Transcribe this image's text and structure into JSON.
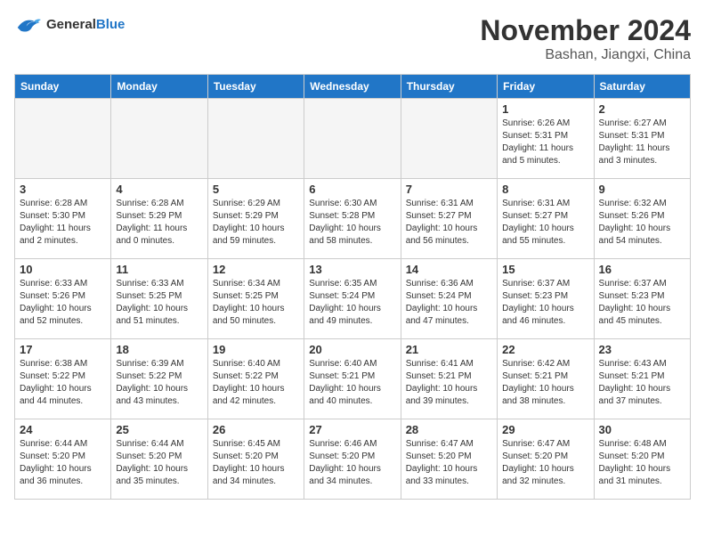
{
  "header": {
    "logo_general": "General",
    "logo_blue": "Blue",
    "month_title": "November 2024",
    "location": "Bashan, Jiangxi, China"
  },
  "weekdays": [
    "Sunday",
    "Monday",
    "Tuesday",
    "Wednesday",
    "Thursday",
    "Friday",
    "Saturday"
  ],
  "weeks": [
    [
      {
        "day": "",
        "info": "",
        "empty": true
      },
      {
        "day": "",
        "info": "",
        "empty": true
      },
      {
        "day": "",
        "info": "",
        "empty": true
      },
      {
        "day": "",
        "info": "",
        "empty": true
      },
      {
        "day": "",
        "info": "",
        "empty": true
      },
      {
        "day": "1",
        "info": "Sunrise: 6:26 AM\nSunset: 5:31 PM\nDaylight: 11 hours\nand 5 minutes."
      },
      {
        "day": "2",
        "info": "Sunrise: 6:27 AM\nSunset: 5:31 PM\nDaylight: 11 hours\nand 3 minutes."
      }
    ],
    [
      {
        "day": "3",
        "info": "Sunrise: 6:28 AM\nSunset: 5:30 PM\nDaylight: 11 hours\nand 2 minutes."
      },
      {
        "day": "4",
        "info": "Sunrise: 6:28 AM\nSunset: 5:29 PM\nDaylight: 11 hours\nand 0 minutes."
      },
      {
        "day": "5",
        "info": "Sunrise: 6:29 AM\nSunset: 5:29 PM\nDaylight: 10 hours\nand 59 minutes."
      },
      {
        "day": "6",
        "info": "Sunrise: 6:30 AM\nSunset: 5:28 PM\nDaylight: 10 hours\nand 58 minutes."
      },
      {
        "day": "7",
        "info": "Sunrise: 6:31 AM\nSunset: 5:27 PM\nDaylight: 10 hours\nand 56 minutes."
      },
      {
        "day": "8",
        "info": "Sunrise: 6:31 AM\nSunset: 5:27 PM\nDaylight: 10 hours\nand 55 minutes."
      },
      {
        "day": "9",
        "info": "Sunrise: 6:32 AM\nSunset: 5:26 PM\nDaylight: 10 hours\nand 54 minutes."
      }
    ],
    [
      {
        "day": "10",
        "info": "Sunrise: 6:33 AM\nSunset: 5:26 PM\nDaylight: 10 hours\nand 52 minutes."
      },
      {
        "day": "11",
        "info": "Sunrise: 6:33 AM\nSunset: 5:25 PM\nDaylight: 10 hours\nand 51 minutes."
      },
      {
        "day": "12",
        "info": "Sunrise: 6:34 AM\nSunset: 5:25 PM\nDaylight: 10 hours\nand 50 minutes."
      },
      {
        "day": "13",
        "info": "Sunrise: 6:35 AM\nSunset: 5:24 PM\nDaylight: 10 hours\nand 49 minutes."
      },
      {
        "day": "14",
        "info": "Sunrise: 6:36 AM\nSunset: 5:24 PM\nDaylight: 10 hours\nand 47 minutes."
      },
      {
        "day": "15",
        "info": "Sunrise: 6:37 AM\nSunset: 5:23 PM\nDaylight: 10 hours\nand 46 minutes."
      },
      {
        "day": "16",
        "info": "Sunrise: 6:37 AM\nSunset: 5:23 PM\nDaylight: 10 hours\nand 45 minutes."
      }
    ],
    [
      {
        "day": "17",
        "info": "Sunrise: 6:38 AM\nSunset: 5:22 PM\nDaylight: 10 hours\nand 44 minutes."
      },
      {
        "day": "18",
        "info": "Sunrise: 6:39 AM\nSunset: 5:22 PM\nDaylight: 10 hours\nand 43 minutes."
      },
      {
        "day": "19",
        "info": "Sunrise: 6:40 AM\nSunset: 5:22 PM\nDaylight: 10 hours\nand 42 minutes."
      },
      {
        "day": "20",
        "info": "Sunrise: 6:40 AM\nSunset: 5:21 PM\nDaylight: 10 hours\nand 40 minutes."
      },
      {
        "day": "21",
        "info": "Sunrise: 6:41 AM\nSunset: 5:21 PM\nDaylight: 10 hours\nand 39 minutes."
      },
      {
        "day": "22",
        "info": "Sunrise: 6:42 AM\nSunset: 5:21 PM\nDaylight: 10 hours\nand 38 minutes."
      },
      {
        "day": "23",
        "info": "Sunrise: 6:43 AM\nSunset: 5:21 PM\nDaylight: 10 hours\nand 37 minutes."
      }
    ],
    [
      {
        "day": "24",
        "info": "Sunrise: 6:44 AM\nSunset: 5:20 PM\nDaylight: 10 hours\nand 36 minutes."
      },
      {
        "day": "25",
        "info": "Sunrise: 6:44 AM\nSunset: 5:20 PM\nDaylight: 10 hours\nand 35 minutes."
      },
      {
        "day": "26",
        "info": "Sunrise: 6:45 AM\nSunset: 5:20 PM\nDaylight: 10 hours\nand 34 minutes."
      },
      {
        "day": "27",
        "info": "Sunrise: 6:46 AM\nSunset: 5:20 PM\nDaylight: 10 hours\nand 34 minutes."
      },
      {
        "day": "28",
        "info": "Sunrise: 6:47 AM\nSunset: 5:20 PM\nDaylight: 10 hours\nand 33 minutes."
      },
      {
        "day": "29",
        "info": "Sunrise: 6:47 AM\nSunset: 5:20 PM\nDaylight: 10 hours\nand 32 minutes."
      },
      {
        "day": "30",
        "info": "Sunrise: 6:48 AM\nSunset: 5:20 PM\nDaylight: 10 hours\nand 31 minutes."
      }
    ]
  ]
}
